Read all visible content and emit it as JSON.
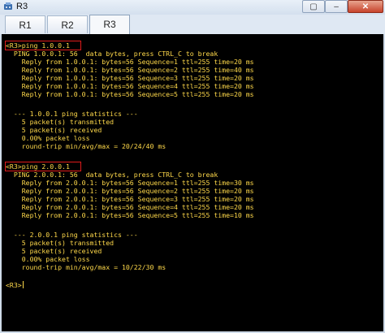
{
  "window": {
    "title": "R3",
    "restore_glyph": "▢",
    "min_glyph": "–",
    "close_glyph": "✕"
  },
  "tabs": [
    {
      "label": "R1"
    },
    {
      "label": "R2"
    },
    {
      "label": "R3",
      "active": true
    }
  ],
  "terminal": {
    "lines": [
      "<R3>ping 1.0.0.1",
      "  PING 1.0.0.1: 56  data bytes, press CTRL_C to break",
      "    Reply from 1.0.0.1: bytes=56 Sequence=1 ttl=255 time=20 ms",
      "    Reply from 1.0.0.1: bytes=56 Sequence=2 ttl=255 time=40 ms",
      "    Reply from 1.0.0.1: bytes=56 Sequence=3 ttl=255 time=20 ms",
      "    Reply from 1.0.0.1: bytes=56 Sequence=4 ttl=255 time=20 ms",
      "    Reply from 1.0.0.1: bytes=56 Sequence=5 ttl=255 time=20 ms",
      "",
      "  --- 1.0.0.1 ping statistics ---",
      "    5 packet(s) transmitted",
      "    5 packet(s) received",
      "    0.00% packet loss",
      "    round-trip min/avg/max = 20/24/40 ms",
      "",
      "<R3>ping 2.0.0.1",
      "  PING 2.0.0.1: 56  data bytes, press CTRL_C to break",
      "    Reply from 2.0.0.1: bytes=56 Sequence=1 ttl=255 time=30 ms",
      "    Reply from 2.0.0.1: bytes=56 Sequence=2 ttl=255 time=20 ms",
      "    Reply from 2.0.0.1: bytes=56 Sequence=3 ttl=255 time=20 ms",
      "    Reply from 2.0.0.1: bytes=56 Sequence=4 ttl=255 time=20 ms",
      "    Reply from 2.0.0.1: bytes=56 Sequence=5 ttl=255 time=10 ms",
      "",
      "  --- 2.0.0.1 ping statistics ---",
      "    5 packet(s) transmitted",
      "    5 packet(s) received",
      "    0.00% packet loss",
      "    round-trip min/avg/max = 10/22/30 ms",
      "",
      "<R3>"
    ]
  },
  "colors": {
    "terminal_bg": "#000000",
    "terminal_fg": "#ffd94a",
    "highlight_box": "#e01b1b"
  }
}
